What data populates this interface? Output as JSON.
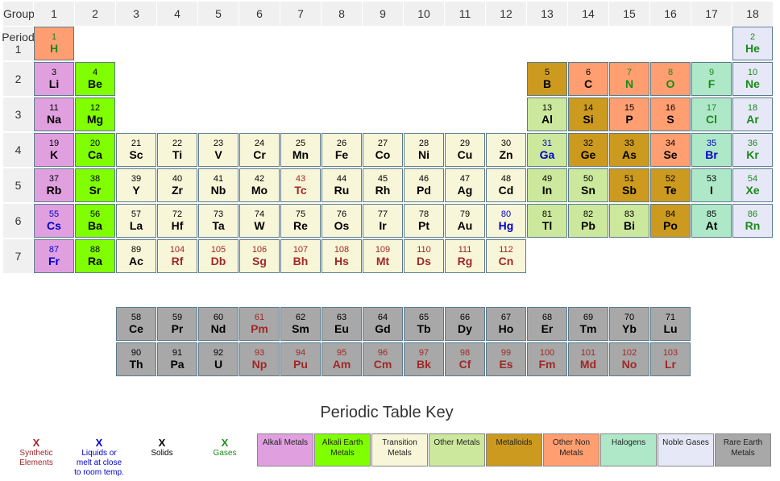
{
  "header": {
    "group_label": "Group",
    "period_label": "Period",
    "groups": [
      "1",
      "2",
      "3",
      "4",
      "5",
      "6",
      "7",
      "8",
      "9",
      "10",
      "11",
      "12",
      "13",
      "14",
      "15",
      "16",
      "17",
      "18"
    ],
    "periods": [
      "1",
      "2",
      "3",
      "4",
      "5",
      "6",
      "7"
    ]
  },
  "colors": {
    "alkali": "#e0a0e0",
    "alkaline_earth": "#80ff00",
    "transition": "#f8f6d8",
    "other_metal": "#cce89c",
    "metalloid": "#cc9a1e",
    "nonmetal": "#ff9e70",
    "halogen": "#aee8c8",
    "noble": "#e6e8f8",
    "rare_earth": "#a8a8a8",
    "solid_text": "#000000",
    "liquid_text": "#0000cc",
    "gas_text": "#1a8a1a",
    "synthetic_text": "#a02828"
  },
  "elements": [
    {
      "n": "1",
      "s": "H",
      "g": 1,
      "p": 1,
      "c": "nonmetal",
      "st": "gas"
    },
    {
      "n": "2",
      "s": "He",
      "g": 18,
      "p": 1,
      "c": "noble",
      "st": "gas"
    },
    {
      "n": "3",
      "s": "Li",
      "g": 1,
      "p": 2,
      "c": "alkali",
      "st": "solid"
    },
    {
      "n": "4",
      "s": "Be",
      "g": 2,
      "p": 2,
      "c": "alkaline_earth",
      "st": "solid"
    },
    {
      "n": "5",
      "s": "B",
      "g": 13,
      "p": 2,
      "c": "metalloid",
      "st": "solid"
    },
    {
      "n": "6",
      "s": "C",
      "g": 14,
      "p": 2,
      "c": "nonmetal",
      "st": "solid"
    },
    {
      "n": "7",
      "s": "N",
      "g": 15,
      "p": 2,
      "c": "nonmetal",
      "st": "gas"
    },
    {
      "n": "8",
      "s": "O",
      "g": 16,
      "p": 2,
      "c": "nonmetal",
      "st": "gas"
    },
    {
      "n": "9",
      "s": "F",
      "g": 17,
      "p": 2,
      "c": "halogen",
      "st": "gas"
    },
    {
      "n": "10",
      "s": "Ne",
      "g": 18,
      "p": 2,
      "c": "noble",
      "st": "gas"
    },
    {
      "n": "11",
      "s": "Na",
      "g": 1,
      "p": 3,
      "c": "alkali",
      "st": "solid"
    },
    {
      "n": "12",
      "s": "Mg",
      "g": 2,
      "p": 3,
      "c": "alkaline_earth",
      "st": "solid"
    },
    {
      "n": "13",
      "s": "Al",
      "g": 13,
      "p": 3,
      "c": "other_metal",
      "st": "solid"
    },
    {
      "n": "14",
      "s": "Si",
      "g": 14,
      "p": 3,
      "c": "metalloid",
      "st": "solid"
    },
    {
      "n": "15",
      "s": "P",
      "g": 15,
      "p": 3,
      "c": "nonmetal",
      "st": "solid"
    },
    {
      "n": "16",
      "s": "S",
      "g": 16,
      "p": 3,
      "c": "nonmetal",
      "st": "solid"
    },
    {
      "n": "17",
      "s": "Cl",
      "g": 17,
      "p": 3,
      "c": "halogen",
      "st": "gas"
    },
    {
      "n": "18",
      "s": "Ar",
      "g": 18,
      "p": 3,
      "c": "noble",
      "st": "gas"
    },
    {
      "n": "19",
      "s": "K",
      "g": 1,
      "p": 4,
      "c": "alkali",
      "st": "solid"
    },
    {
      "n": "20",
      "s": "Ca",
      "g": 2,
      "p": 4,
      "c": "alkaline_earth",
      "st": "solid"
    },
    {
      "n": "21",
      "s": "Sc",
      "g": 3,
      "p": 4,
      "c": "transition",
      "st": "solid"
    },
    {
      "n": "22",
      "s": "Ti",
      "g": 4,
      "p": 4,
      "c": "transition",
      "st": "solid"
    },
    {
      "n": "23",
      "s": "V",
      "g": 5,
      "p": 4,
      "c": "transition",
      "st": "solid"
    },
    {
      "n": "24",
      "s": "Cr",
      "g": 6,
      "p": 4,
      "c": "transition",
      "st": "solid"
    },
    {
      "n": "25",
      "s": "Mn",
      "g": 7,
      "p": 4,
      "c": "transition",
      "st": "solid"
    },
    {
      "n": "26",
      "s": "Fe",
      "g": 8,
      "p": 4,
      "c": "transition",
      "st": "solid"
    },
    {
      "n": "27",
      "s": "Co",
      "g": 9,
      "p": 4,
      "c": "transition",
      "st": "solid"
    },
    {
      "n": "28",
      "s": "Ni",
      "g": 10,
      "p": 4,
      "c": "transition",
      "st": "solid"
    },
    {
      "n": "29",
      "s": "Cu",
      "g": 11,
      "p": 4,
      "c": "transition",
      "st": "solid"
    },
    {
      "n": "30",
      "s": "Zn",
      "g": 12,
      "p": 4,
      "c": "transition",
      "st": "solid"
    },
    {
      "n": "31",
      "s": "Ga",
      "g": 13,
      "p": 4,
      "c": "other_metal",
      "st": "liquid"
    },
    {
      "n": "32",
      "s": "Ge",
      "g": 14,
      "p": 4,
      "c": "metalloid",
      "st": "solid"
    },
    {
      "n": "33",
      "s": "As",
      "g": 15,
      "p": 4,
      "c": "metalloid",
      "st": "solid"
    },
    {
      "n": "34",
      "s": "Se",
      "g": 16,
      "p": 4,
      "c": "nonmetal",
      "st": "solid"
    },
    {
      "n": "35",
      "s": "Br",
      "g": 17,
      "p": 4,
      "c": "halogen",
      "st": "liquid"
    },
    {
      "n": "36",
      "s": "Kr",
      "g": 18,
      "p": 4,
      "c": "noble",
      "st": "gas"
    },
    {
      "n": "37",
      "s": "Rb",
      "g": 1,
      "p": 5,
      "c": "alkali",
      "st": "solid"
    },
    {
      "n": "38",
      "s": "Sr",
      "g": 2,
      "p": 5,
      "c": "alkaline_earth",
      "st": "solid"
    },
    {
      "n": "39",
      "s": "Y",
      "g": 3,
      "p": 5,
      "c": "transition",
      "st": "solid"
    },
    {
      "n": "40",
      "s": "Zr",
      "g": 4,
      "p": 5,
      "c": "transition",
      "st": "solid"
    },
    {
      "n": "41",
      "s": "Nb",
      "g": 5,
      "p": 5,
      "c": "transition",
      "st": "solid"
    },
    {
      "n": "42",
      "s": "Mo",
      "g": 6,
      "p": 5,
      "c": "transition",
      "st": "solid"
    },
    {
      "n": "43",
      "s": "Tc",
      "g": 7,
      "p": 5,
      "c": "transition",
      "st": "synthetic"
    },
    {
      "n": "44",
      "s": "Ru",
      "g": 8,
      "p": 5,
      "c": "transition",
      "st": "solid"
    },
    {
      "n": "45",
      "s": "Rh",
      "g": 9,
      "p": 5,
      "c": "transition",
      "st": "solid"
    },
    {
      "n": "46",
      "s": "Pd",
      "g": 10,
      "p": 5,
      "c": "transition",
      "st": "solid"
    },
    {
      "n": "47",
      "s": "Ag",
      "g": 11,
      "p": 5,
      "c": "transition",
      "st": "solid"
    },
    {
      "n": "48",
      "s": "Cd",
      "g": 12,
      "p": 5,
      "c": "transition",
      "st": "solid"
    },
    {
      "n": "49",
      "s": "In",
      "g": 13,
      "p": 5,
      "c": "other_metal",
      "st": "solid"
    },
    {
      "n": "50",
      "s": "Sn",
      "g": 14,
      "p": 5,
      "c": "other_metal",
      "st": "solid"
    },
    {
      "n": "51",
      "s": "Sb",
      "g": 15,
      "p": 5,
      "c": "metalloid",
      "st": "solid"
    },
    {
      "n": "52",
      "s": "Te",
      "g": 16,
      "p": 5,
      "c": "metalloid",
      "st": "solid"
    },
    {
      "n": "53",
      "s": "I",
      "g": 17,
      "p": 5,
      "c": "halogen",
      "st": "solid"
    },
    {
      "n": "54",
      "s": "Xe",
      "g": 18,
      "p": 5,
      "c": "noble",
      "st": "gas"
    },
    {
      "n": "55",
      "s": "Cs",
      "g": 1,
      "p": 6,
      "c": "alkali",
      "st": "liquid"
    },
    {
      "n": "56",
      "s": "Ba",
      "g": 2,
      "p": 6,
      "c": "alkaline_earth",
      "st": "solid"
    },
    {
      "n": "57",
      "s": "La",
      "g": 3,
      "p": 6,
      "c": "transition",
      "st": "solid"
    },
    {
      "n": "72",
      "s": "Hf",
      "g": 4,
      "p": 6,
      "c": "transition",
      "st": "solid"
    },
    {
      "n": "73",
      "s": "Ta",
      "g": 5,
      "p": 6,
      "c": "transition",
      "st": "solid"
    },
    {
      "n": "74",
      "s": "W",
      "g": 6,
      "p": 6,
      "c": "transition",
      "st": "solid"
    },
    {
      "n": "75",
      "s": "Re",
      "g": 7,
      "p": 6,
      "c": "transition",
      "st": "solid"
    },
    {
      "n": "76",
      "s": "Os",
      "g": 8,
      "p": 6,
      "c": "transition",
      "st": "solid"
    },
    {
      "n": "77",
      "s": "Ir",
      "g": 9,
      "p": 6,
      "c": "transition",
      "st": "solid"
    },
    {
      "n": "78",
      "s": "Pt",
      "g": 10,
      "p": 6,
      "c": "transition",
      "st": "solid"
    },
    {
      "n": "79",
      "s": "Au",
      "g": 11,
      "p": 6,
      "c": "transition",
      "st": "solid"
    },
    {
      "n": "80",
      "s": "Hg",
      "g": 12,
      "p": 6,
      "c": "transition",
      "st": "liquid"
    },
    {
      "n": "81",
      "s": "Tl",
      "g": 13,
      "p": 6,
      "c": "other_metal",
      "st": "solid"
    },
    {
      "n": "82",
      "s": "Pb",
      "g": 14,
      "p": 6,
      "c": "other_metal",
      "st": "solid"
    },
    {
      "n": "83",
      "s": "Bi",
      "g": 15,
      "p": 6,
      "c": "other_metal",
      "st": "solid"
    },
    {
      "n": "84",
      "s": "Po",
      "g": 16,
      "p": 6,
      "c": "metalloid",
      "st": "solid"
    },
    {
      "n": "85",
      "s": "At",
      "g": 17,
      "p": 6,
      "c": "halogen",
      "st": "solid"
    },
    {
      "n": "86",
      "s": "Rn",
      "g": 18,
      "p": 6,
      "c": "noble",
      "st": "gas"
    },
    {
      "n": "87",
      "s": "Fr",
      "g": 1,
      "p": 7,
      "c": "alkali",
      "st": "liquid"
    },
    {
      "n": "88",
      "s": "Ra",
      "g": 2,
      "p": 7,
      "c": "alkaline_earth",
      "st": "solid"
    },
    {
      "n": "89",
      "s": "Ac",
      "g": 3,
      "p": 7,
      "c": "transition",
      "st": "solid"
    },
    {
      "n": "104",
      "s": "Rf",
      "g": 4,
      "p": 7,
      "c": "transition",
      "st": "synthetic"
    },
    {
      "n": "105",
      "s": "Db",
      "g": 5,
      "p": 7,
      "c": "transition",
      "st": "synthetic"
    },
    {
      "n": "106",
      "s": "Sg",
      "g": 6,
      "p": 7,
      "c": "transition",
      "st": "synthetic"
    },
    {
      "n": "107",
      "s": "Bh",
      "g": 7,
      "p": 7,
      "c": "transition",
      "st": "synthetic"
    },
    {
      "n": "108",
      "s": "Hs",
      "g": 8,
      "p": 7,
      "c": "transition",
      "st": "synthetic"
    },
    {
      "n": "109",
      "s": "Mt",
      "g": 9,
      "p": 7,
      "c": "transition",
      "st": "synthetic"
    },
    {
      "n": "110",
      "s": "Ds",
      "g": 10,
      "p": 7,
      "c": "transition",
      "st": "synthetic"
    },
    {
      "n": "111",
      "s": "Rg",
      "g": 11,
      "p": 7,
      "c": "transition",
      "st": "synthetic"
    },
    {
      "n": "112",
      "s": "Cn",
      "g": 12,
      "p": 7,
      "c": "transition",
      "st": "synthetic"
    },
    {
      "n": "58",
      "s": "Ce",
      "g": 3,
      "p": 8,
      "c": "rare_earth",
      "st": "solid"
    },
    {
      "n": "59",
      "s": "Pr",
      "g": 4,
      "p": 8,
      "c": "rare_earth",
      "st": "solid"
    },
    {
      "n": "60",
      "s": "Nd",
      "g": 5,
      "p": 8,
      "c": "rare_earth",
      "st": "solid"
    },
    {
      "n": "61",
      "s": "Pm",
      "g": 6,
      "p": 8,
      "c": "rare_earth",
      "st": "synthetic"
    },
    {
      "n": "62",
      "s": "Sm",
      "g": 7,
      "p": 8,
      "c": "rare_earth",
      "st": "solid"
    },
    {
      "n": "63",
      "s": "Eu",
      "g": 8,
      "p": 8,
      "c": "rare_earth",
      "st": "solid"
    },
    {
      "n": "64",
      "s": "Gd",
      "g": 9,
      "p": 8,
      "c": "rare_earth",
      "st": "solid"
    },
    {
      "n": "65",
      "s": "Tb",
      "g": 10,
      "p": 8,
      "c": "rare_earth",
      "st": "solid"
    },
    {
      "n": "66",
      "s": "Dy",
      "g": 11,
      "p": 8,
      "c": "rare_earth",
      "st": "solid"
    },
    {
      "n": "67",
      "s": "Ho",
      "g": 12,
      "p": 8,
      "c": "rare_earth",
      "st": "solid"
    },
    {
      "n": "68",
      "s": "Er",
      "g": 13,
      "p": 8,
      "c": "rare_earth",
      "st": "solid"
    },
    {
      "n": "69",
      "s": "Tm",
      "g": 14,
      "p": 8,
      "c": "rare_earth",
      "st": "solid"
    },
    {
      "n": "70",
      "s": "Yb",
      "g": 15,
      "p": 8,
      "c": "rare_earth",
      "st": "solid"
    },
    {
      "n": "71",
      "s": "Lu",
      "g": 16,
      "p": 8,
      "c": "rare_earth",
      "st": "solid"
    },
    {
      "n": "90",
      "s": "Th",
      "g": 3,
      "p": 9,
      "c": "rare_earth",
      "st": "solid"
    },
    {
      "n": "91",
      "s": "Pa",
      "g": 4,
      "p": 9,
      "c": "rare_earth",
      "st": "solid"
    },
    {
      "n": "92",
      "s": "U",
      "g": 5,
      "p": 9,
      "c": "rare_earth",
      "st": "solid"
    },
    {
      "n": "93",
      "s": "Np",
      "g": 6,
      "p": 9,
      "c": "rare_earth",
      "st": "synthetic"
    },
    {
      "n": "94",
      "s": "Pu",
      "g": 7,
      "p": 9,
      "c": "rare_earth",
      "st": "synthetic"
    },
    {
      "n": "95",
      "s": "Am",
      "g": 8,
      "p": 9,
      "c": "rare_earth",
      "st": "synthetic"
    },
    {
      "n": "96",
      "s": "Cm",
      "g": 9,
      "p": 9,
      "c": "rare_earth",
      "st": "synthetic"
    },
    {
      "n": "97",
      "s": "Bk",
      "g": 10,
      "p": 9,
      "c": "rare_earth",
      "st": "synthetic"
    },
    {
      "n": "98",
      "s": "Cf",
      "g": 11,
      "p": 9,
      "c": "rare_earth",
      "st": "synthetic"
    },
    {
      "n": "99",
      "s": "Es",
      "g": 12,
      "p": 9,
      "c": "rare_earth",
      "st": "synthetic"
    },
    {
      "n": "100",
      "s": "Fm",
      "g": 13,
      "p": 9,
      "c": "rare_earth",
      "st": "synthetic"
    },
    {
      "n": "101",
      "s": "Md",
      "g": 14,
      "p": 9,
      "c": "rare_earth",
      "st": "synthetic"
    },
    {
      "n": "102",
      "s": "No",
      "g": 15,
      "p": 9,
      "c": "rare_earth",
      "st": "synthetic"
    },
    {
      "n": "103",
      "s": "Lr",
      "g": 16,
      "p": 9,
      "c": "rare_earth",
      "st": "synthetic"
    }
  ],
  "key": {
    "title": "Periodic Table Key",
    "marker": "X",
    "states": [
      {
        "id": "synthetic",
        "label": "Synthetic Elements"
      },
      {
        "id": "liquid",
        "label": "Liquids or melt at close to room temp."
      },
      {
        "id": "solid",
        "label": "Solids"
      },
      {
        "id": "gas",
        "label": "Gases"
      }
    ],
    "categories": [
      {
        "id": "alkali",
        "label": "Alkali Metals"
      },
      {
        "id": "alkaline_earth",
        "label": "Alkali Earth Metals"
      },
      {
        "id": "transition",
        "label": "Transition Metals"
      },
      {
        "id": "other_metal",
        "label": "Other Metals"
      },
      {
        "id": "metalloid",
        "label": "Metalloids"
      },
      {
        "id": "nonmetal",
        "label": "Other Non Metals"
      },
      {
        "id": "halogen",
        "label": "Halogens"
      },
      {
        "id": "noble",
        "label": "Noble Gases"
      },
      {
        "id": "rare_earth",
        "label": "Rare Earth Metals"
      }
    ]
  }
}
